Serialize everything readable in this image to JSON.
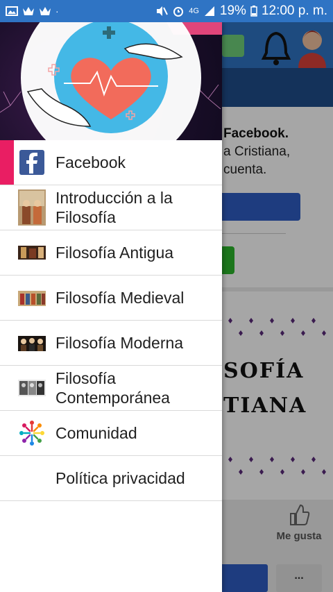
{
  "status_bar": {
    "battery": "19%",
    "time": "12:00 p. m.",
    "network": "4G"
  },
  "drawer": {
    "items": [
      {
        "label": "Facebook",
        "icon": "facebook-icon",
        "active": true
      },
      {
        "label": "Introducción a la Filosofía",
        "icon": "philosophers-painting-icon"
      },
      {
        "label": "Filosofía Antigua",
        "icon": "ancient-painting-icon"
      },
      {
        "label": "Filosofía Medieval",
        "icon": "medieval-painting-icon"
      },
      {
        "label": "Filosofía Moderna",
        "icon": "modern-painting-icon"
      },
      {
        "label": "Filosofía Contemporánea",
        "icon": "contemporary-photo-icon"
      },
      {
        "label": "Comunidad",
        "icon": "community-icon"
      },
      {
        "label": "Política privacidad",
        "icon": ""
      }
    ]
  },
  "background": {
    "card_title": "Facebook.",
    "card_line1": "a Cristiana,",
    "card_line2": "cuenta.",
    "banner_line1": "SOFÍA",
    "banner_line2": "TIANA",
    "like_label": "Me gusta",
    "more_label": "..."
  },
  "colors": {
    "statusbar": "#2f74c4",
    "accent_active": "#e91e63",
    "facebook": "#3b5998"
  }
}
